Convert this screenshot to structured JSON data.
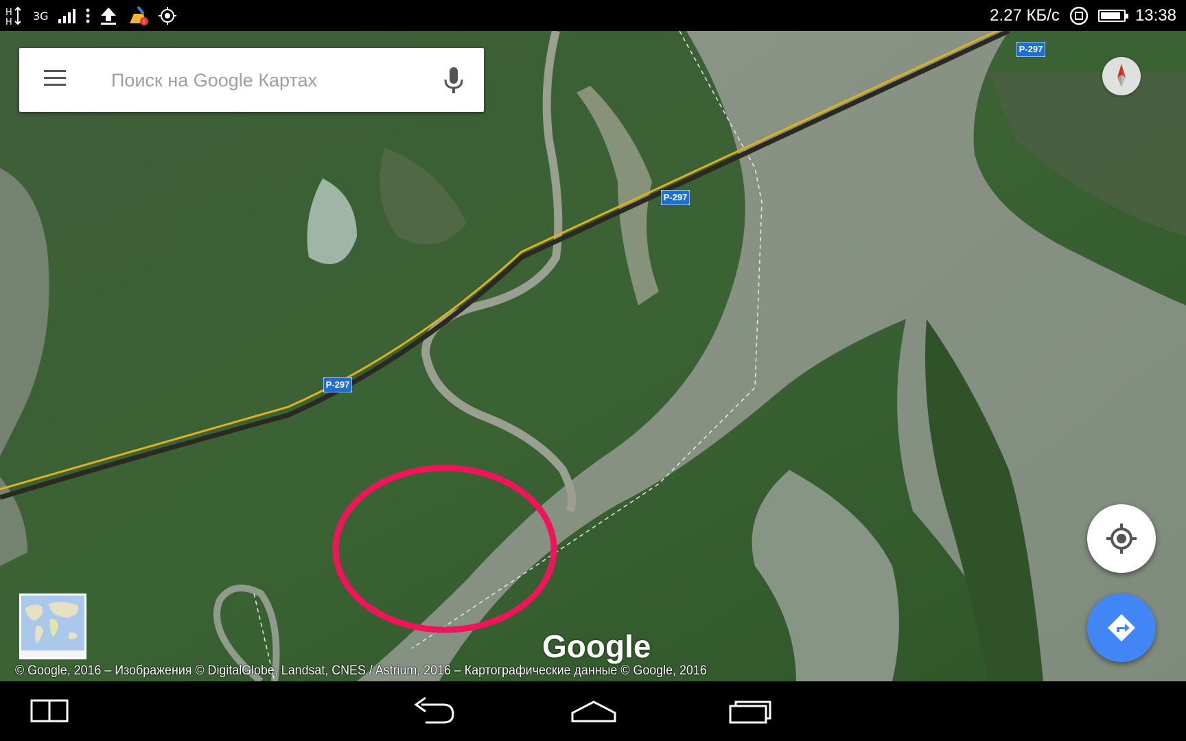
{
  "status_bar": {
    "signal_label": "3G",
    "network_speed": "2.27 КБ/с",
    "time": "13:38"
  },
  "search": {
    "placeholder": "Поиск на Google Картах"
  },
  "map": {
    "road_labels": [
      "P-297",
      "P-297",
      "P-297"
    ],
    "logo": "Google",
    "attribution": "© Google, 2016 – Изображения © DigitalGlobe, Landsat, CNES / Astrium, 2016 – Картографические данные © Google, 2016",
    "highlight_color": "#f0145a"
  },
  "colors": {
    "fab_blue": "#4285f4",
    "road_yellow": "#e0b21a",
    "shield_blue": "#1c6fd6"
  },
  "icons": {
    "menu": "menu-icon",
    "mic": "mic-icon",
    "compass": "compass-icon",
    "my_location": "my-location-icon",
    "directions": "directions-icon",
    "nav_back": "back-icon",
    "nav_home": "home-icon",
    "nav_recents": "recents-icon"
  }
}
